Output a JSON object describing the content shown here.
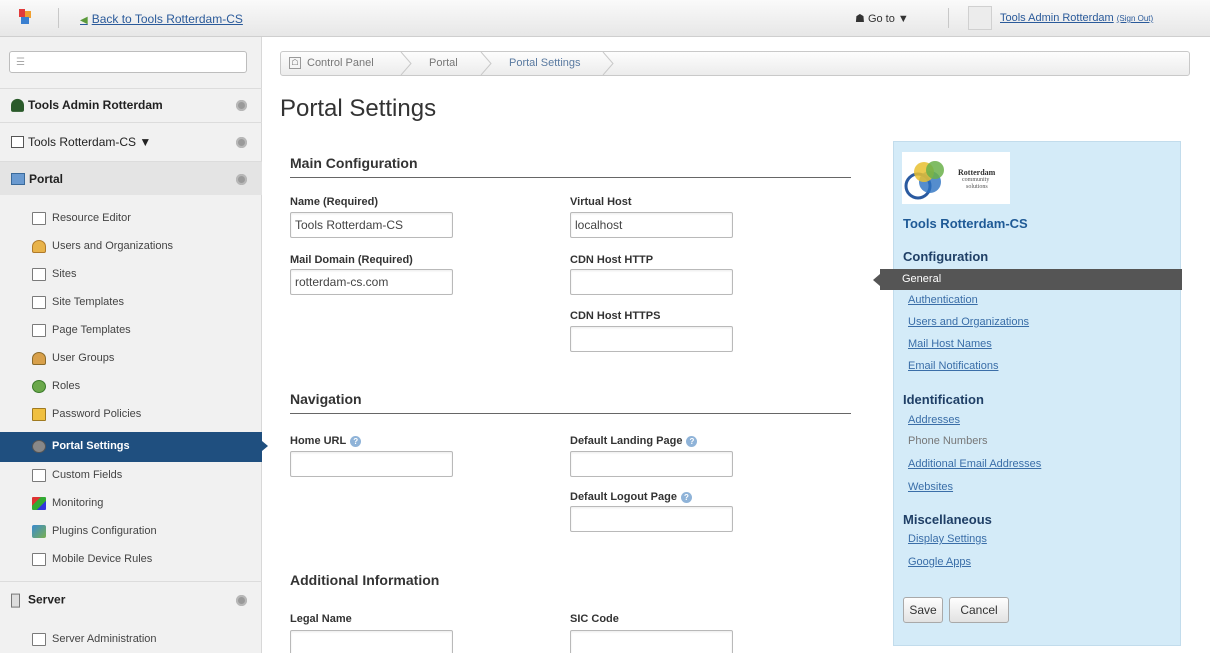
{
  "topbar": {
    "back_label": "Back to Tools Rotterdam-CS",
    "goto_label": "Go to",
    "user_name": "Tools Admin Rotterdam",
    "sign_out": "(Sign Out)"
  },
  "sidebar": {
    "search_placeholder": "",
    "user_heading": "Tools Admin Rotterdam",
    "site_heading": "Tools Rotterdam-CS ▼",
    "portal_heading": "Portal",
    "portal_items": [
      {
        "label": "Resource Editor",
        "icon": "resource-editor-icon"
      },
      {
        "label": "Users and Organizations",
        "icon": "users-icon"
      },
      {
        "label": "Sites",
        "icon": "sites-icon"
      },
      {
        "label": "Site Templates",
        "icon": "site-templates-icon"
      },
      {
        "label": "Page Templates",
        "icon": "page-templates-icon"
      },
      {
        "label": "User Groups",
        "icon": "user-groups-icon"
      },
      {
        "label": "Roles",
        "icon": "roles-icon"
      },
      {
        "label": "Password Policies",
        "icon": "password-policies-icon"
      },
      {
        "label": "Portal Settings",
        "icon": "portal-settings-icon"
      },
      {
        "label": "Custom Fields",
        "icon": "custom-fields-icon"
      },
      {
        "label": "Monitoring",
        "icon": "monitoring-icon"
      },
      {
        "label": "Plugins Configuration",
        "icon": "plugins-icon"
      },
      {
        "label": "Mobile Device Rules",
        "icon": "mobile-rules-icon"
      }
    ],
    "server_heading": "Server",
    "server_items": [
      {
        "label": "Server Administration",
        "icon": "server-admin-icon"
      }
    ]
  },
  "breadcrumb": [
    "Control Panel",
    "Portal",
    "Portal Settings"
  ],
  "page_title": "Portal Settings",
  "main_config": {
    "heading": "Main Configuration",
    "name_label": "Name (Required)",
    "name_value": "Tools Rotterdam-CS",
    "virtual_host_label": "Virtual Host",
    "virtual_host_value": "localhost",
    "mail_domain_label": "Mail Domain (Required)",
    "mail_domain_value": "rotterdam-cs.com",
    "cdn_http_label": "CDN Host HTTP",
    "cdn_http_value": "",
    "cdn_https_label": "CDN Host HTTPS",
    "cdn_https_value": ""
  },
  "navigation": {
    "heading": "Navigation",
    "home_url_label": "Home URL",
    "home_url_value": "",
    "landing_label": "Default Landing Page",
    "landing_value": "",
    "logout_label": "Default Logout Page",
    "logout_value": ""
  },
  "additional": {
    "heading": "Additional Information",
    "legal_name_label": "Legal Name",
    "legal_name_value": "",
    "sic_code_label": "SIC Code",
    "sic_code_value": ""
  },
  "right_panel": {
    "org_logo_text": [
      "Rotterdam",
      "community",
      "solutions"
    ],
    "org_name": "Tools Rotterdam-CS",
    "configuration_heading": "Configuration",
    "configuration_links": [
      "General",
      "Authentication",
      "Users and Organizations",
      "Mail Host Names",
      "Email Notifications"
    ],
    "identification_heading": "Identification",
    "identification_links": [
      "Addresses",
      "Phone Numbers",
      "Additional Email Addresses",
      "Websites"
    ],
    "misc_heading": "Miscellaneous",
    "misc_links": [
      "Display Settings",
      "Google Apps"
    ],
    "save_label": "Save",
    "cancel_label": "Cancel"
  },
  "colors": {
    "active_nav": "#1f4f7f",
    "panel_bg": "#d4ebf8",
    "link": "#3a6ea8"
  }
}
